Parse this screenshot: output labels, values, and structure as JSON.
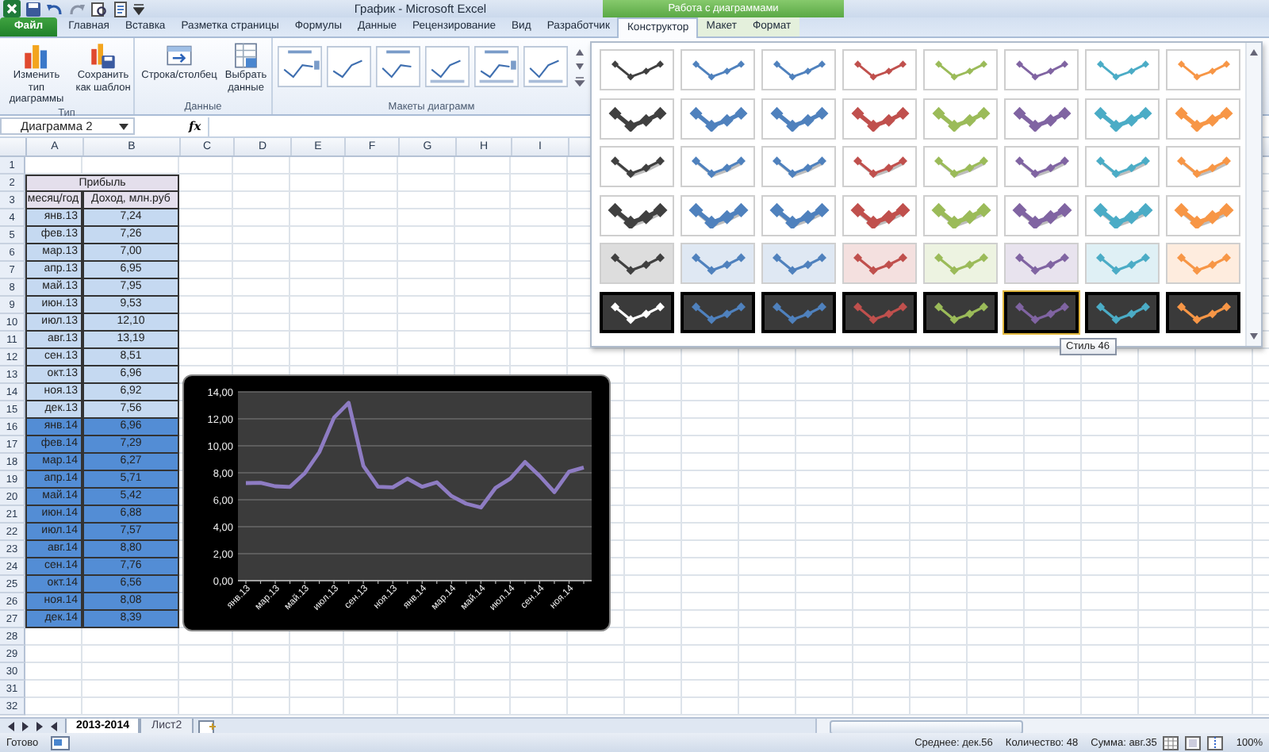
{
  "title_bar": {
    "title": "График - Microsoft Excel",
    "context_group": "Работа с диаграммами"
  },
  "tabs": [
    {
      "label": "Файл",
      "kind": "file",
      "selected": false
    },
    {
      "label": "Главная",
      "kind": "normal",
      "selected": false
    },
    {
      "label": "Вставка",
      "kind": "normal",
      "selected": false
    },
    {
      "label": "Разметка страницы",
      "kind": "normal",
      "selected": false
    },
    {
      "label": "Формулы",
      "kind": "normal",
      "selected": false
    },
    {
      "label": "Данные",
      "kind": "normal",
      "selected": false
    },
    {
      "label": "Рецензирование",
      "kind": "normal",
      "selected": false
    },
    {
      "label": "Вид",
      "kind": "normal",
      "selected": false
    },
    {
      "label": "Разработчик",
      "kind": "normal",
      "selected": false
    },
    {
      "label": "Конструктор",
      "kind": "context",
      "selected": true
    },
    {
      "label": "Макет",
      "kind": "context",
      "selected": false
    },
    {
      "label": "Формат",
      "kind": "context",
      "selected": false
    }
  ],
  "ribbon_groups": [
    {
      "label": "Тип",
      "buttons": [
        "Изменить тип диаграммы",
        "Сохранить как шаблон"
      ]
    },
    {
      "label": "Данные",
      "buttons": [
        "Строка/столбец",
        "Выбрать данные"
      ]
    },
    {
      "label": "Макеты диаграмм"
    }
  ],
  "formula_bar": {
    "name_box": "Диаграмма 2",
    "fx": "fx"
  },
  "sheet": {
    "columns": [
      "A",
      "B",
      "C",
      "D",
      "E",
      "F",
      "G",
      "H",
      "I"
    ],
    "row_numbers": [
      "1",
      "2",
      "3",
      "4",
      "5",
      "6",
      "7",
      "8",
      "9",
      "10",
      "11",
      "12",
      "13",
      "14",
      "15",
      "16",
      "17",
      "18",
      "19",
      "20",
      "21",
      "22",
      "23",
      "24",
      "25",
      "26",
      "27",
      "28",
      "29",
      "30",
      "31",
      "32"
    ]
  },
  "table": {
    "title": "Прибыль",
    "headers": [
      "месяц/год",
      "Доход, млн.руб"
    ],
    "rows": [
      {
        "month": "янв.13",
        "value": "7,24",
        "color": "#c5d9f1"
      },
      {
        "month": "фев.13",
        "value": "7,26",
        "color": "#c5d9f1"
      },
      {
        "month": "мар.13",
        "value": "7,00",
        "color": "#c5d9f1"
      },
      {
        "month": "апр.13",
        "value": "6,95",
        "color": "#c5d9f1"
      },
      {
        "month": "май.13",
        "value": "7,95",
        "color": "#c5d9f1"
      },
      {
        "month": "июн.13",
        "value": "9,53",
        "color": "#c5d9f1"
      },
      {
        "month": "июл.13",
        "value": "12,10",
        "color": "#c5d9f1"
      },
      {
        "month": "авг.13",
        "value": "13,19",
        "color": "#c5d9f1"
      },
      {
        "month": "сен.13",
        "value": "8,51",
        "color": "#c5d9f1"
      },
      {
        "month": "окт.13",
        "value": "6,96",
        "color": "#c5d9f1"
      },
      {
        "month": "ноя.13",
        "value": "6,92",
        "color": "#c5d9f1"
      },
      {
        "month": "дек.13",
        "value": "7,56",
        "color": "#c5d9f1"
      },
      {
        "month": "янв.14",
        "value": "6,96",
        "color": "#538dd5"
      },
      {
        "month": "фев.14",
        "value": "7,29",
        "color": "#538dd5"
      },
      {
        "month": "мар.14",
        "value": "6,27",
        "color": "#538dd5"
      },
      {
        "month": "апр.14",
        "value": "5,71",
        "color": "#538dd5"
      },
      {
        "month": "май.14",
        "value": "5,42",
        "color": "#538dd5"
      },
      {
        "month": "июн.14",
        "value": "6,88",
        "color": "#538dd5"
      },
      {
        "month": "июл.14",
        "value": "7,57",
        "color": "#538dd5"
      },
      {
        "month": "авг.14",
        "value": "8,80",
        "color": "#538dd5"
      },
      {
        "month": "сен.14",
        "value": "7,76",
        "color": "#538dd5"
      },
      {
        "month": "окт.14",
        "value": "6,56",
        "color": "#538dd5"
      },
      {
        "month": "ноя.14",
        "value": "8,08",
        "color": "#538dd5"
      },
      {
        "month": "дек.14",
        "value": "8,39",
        "color": "#538dd5"
      }
    ]
  },
  "chart": {
    "chart_data": {
      "type": "line",
      "categories": [
        "янв.13",
        null,
        "мар.13",
        null,
        "май.13",
        null,
        "июл.13",
        null,
        "сен.13",
        null,
        "ноя.13",
        null,
        "янв.14",
        null,
        "мар.14",
        null,
        "май.14",
        null,
        "июл.14",
        null,
        "сен.14",
        null,
        "ноя.14",
        null
      ],
      "grid": true,
      "series": [
        {
          "color": "#8e7cc3",
          "values": [
            7.24,
            7.26,
            7.0,
            6.95,
            7.95,
            9.53,
            12.1,
            13.19,
            8.51,
            6.96,
            6.92,
            7.56,
            6.96,
            7.29,
            6.27,
            5.71,
            5.42,
            6.88,
            7.57,
            8.8,
            7.76,
            6.56,
            8.08,
            8.39
          ]
        }
      ],
      "ylim": [
        0,
        14
      ],
      "yticks": [
        {
          "value": 0,
          "label": "0,00"
        },
        {
          "value": 2,
          "label": "2,00"
        },
        {
          "value": 4,
          "label": "4,00"
        },
        {
          "value": 6,
          "label": "6,00"
        },
        {
          "value": 8,
          "label": "8,00"
        },
        {
          "value": 10,
          "label": "10,00"
        },
        {
          "value": 12,
          "label": "12,00"
        },
        {
          "value": 14,
          "label": "14,00"
        }
      ]
    }
  },
  "style_gallery": {
    "tooltip": "Стиль 46",
    "rows": [
      {
        "kind": "thin",
        "styles": [
          {
            "color": "#404040",
            "selected": false
          },
          {
            "color": "#4f81bd",
            "selected": false
          },
          {
            "color": "#4f81bd",
            "selected": false
          },
          {
            "color": "#c0504d",
            "selected": false
          },
          {
            "color": "#9bbb59",
            "selected": false
          },
          {
            "color": "#8064a2",
            "selected": false
          },
          {
            "color": "#4bacc6",
            "selected": false
          },
          {
            "color": "#f79646",
            "selected": false
          }
        ]
      },
      {
        "kind": "thick",
        "styles": [
          {
            "color": "#404040",
            "selected": false
          },
          {
            "color": "#4f81bd",
            "selected": false
          },
          {
            "color": "#4f81bd",
            "selected": false
          },
          {
            "color": "#c0504d",
            "selected": false
          },
          {
            "color": "#9bbb59",
            "selected": false
          },
          {
            "color": "#8064a2",
            "selected": false
          },
          {
            "color": "#4bacc6",
            "selected": false
          },
          {
            "color": "#f79646",
            "selected": false
          }
        ]
      },
      {
        "kind": "shadow",
        "styles": [
          {
            "color": "#404040",
            "selected": false
          },
          {
            "color": "#4f81bd",
            "selected": false
          },
          {
            "color": "#4f81bd",
            "selected": false
          },
          {
            "color": "#c0504d",
            "selected": false
          },
          {
            "color": "#9bbb59",
            "selected": false
          },
          {
            "color": "#8064a2",
            "selected": false
          },
          {
            "color": "#4bacc6",
            "selected": false
          },
          {
            "color": "#f79646",
            "selected": false
          }
        ]
      },
      {
        "kind": "bevel",
        "styles": [
          {
            "color": "#404040",
            "selected": false
          },
          {
            "color": "#4f81bd",
            "selected": false
          },
          {
            "color": "#4f81bd",
            "selected": false
          },
          {
            "color": "#c0504d",
            "selected": false
          },
          {
            "color": "#9bbb59",
            "selected": false
          },
          {
            "color": "#8064a2",
            "selected": false
          },
          {
            "color": "#4bacc6",
            "selected": false
          },
          {
            "color": "#f79646",
            "selected": false
          }
        ]
      },
      {
        "kind": "tinted",
        "styles": [
          {
            "color": "#404040",
            "selected": false
          },
          {
            "color": "#4f81bd",
            "selected": false
          },
          {
            "color": "#4f81bd",
            "selected": false
          },
          {
            "color": "#c0504d",
            "selected": false
          },
          {
            "color": "#9bbb59",
            "selected": false
          },
          {
            "color": "#8064a2",
            "selected": false
          },
          {
            "color": "#4bacc6",
            "selected": false
          },
          {
            "color": "#f79646",
            "selected": false
          }
        ]
      },
      {
        "kind": "dark",
        "styles": [
          {
            "color": "#ffffff",
            "selected": false
          },
          {
            "color": "#4f81bd",
            "selected": false
          },
          {
            "color": "#4f81bd",
            "selected": false
          },
          {
            "color": "#c0504d",
            "selected": false
          },
          {
            "color": "#9bbb59",
            "selected": false
          },
          {
            "color": "#8064a2",
            "selected": true
          },
          {
            "color": "#4bacc6",
            "selected": false
          },
          {
            "color": "#f79646",
            "selected": false
          }
        ]
      }
    ]
  },
  "sheet_tabs": [
    {
      "label": "2013-2014",
      "selected": true
    },
    {
      "label": "Лист2",
      "selected": false
    }
  ],
  "status_bar": {
    "state": "Готово",
    "average": "Среднее: дек.56",
    "count": "Количество: 48",
    "sum": "Сумма: авг.35",
    "zoom": "100%"
  }
}
